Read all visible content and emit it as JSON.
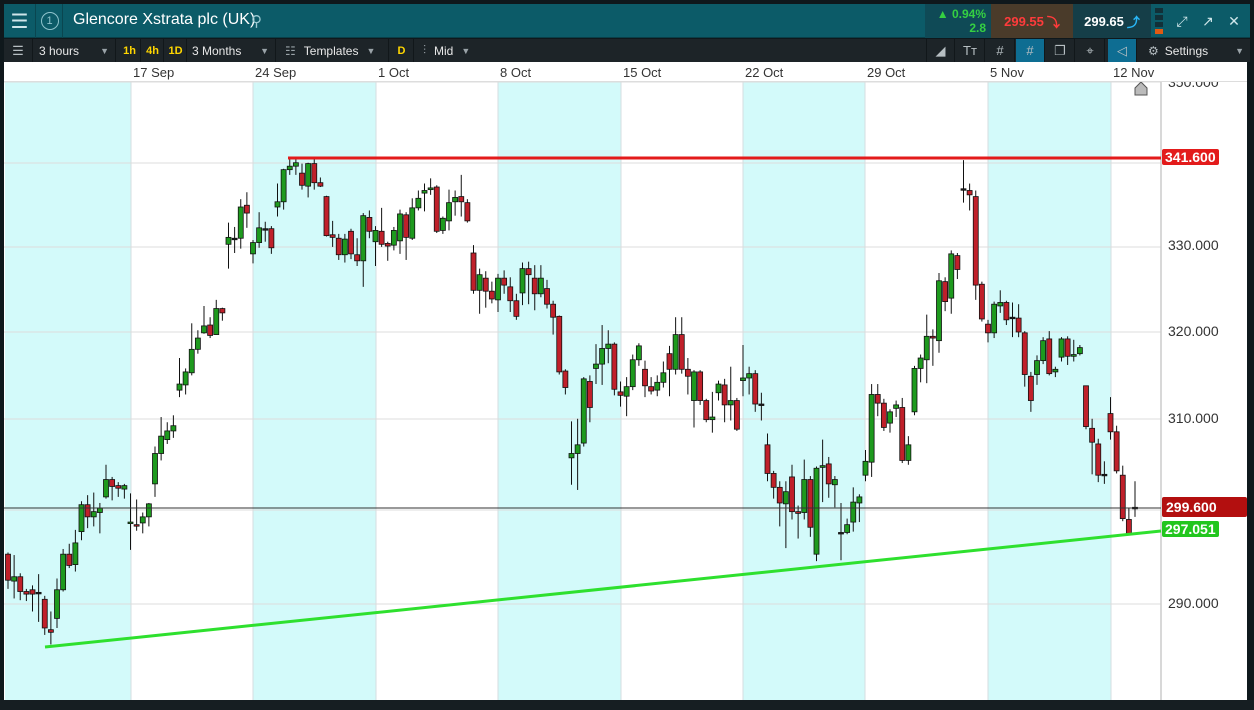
{
  "header": {
    "title": "Glencore Xstrata plc (UK)",
    "change_pct": "▲ 0.94%",
    "change_abs": "2.8",
    "sell_price": "299.55",
    "buy_price": "299.65",
    "watch_number": "1"
  },
  "toolbar": {
    "interval": "3 hours",
    "quick": [
      "1h",
      "4h",
      "1D"
    ],
    "range": "3 Months",
    "templates": "Templates",
    "d_label": "D",
    "price_type": "Mid",
    "settings": "Settings"
  },
  "colors": {
    "up": "#1e9a1e",
    "down": "#c0202a",
    "resistance": "#e31b1b",
    "support": "#2ee02e",
    "shade": "#d3fafa"
  },
  "chart_data": {
    "type": "candlestick",
    "interval": "3 hours",
    "x_ticks": [
      "17 Sep",
      "24 Sep",
      "1 Oct",
      "8 Oct",
      "15 Oct",
      "22 Oct",
      "29 Oct",
      "5 Nov",
      "12 Nov"
    ],
    "y_ticks": [
      "350.000",
      "330.000",
      "320.000",
      "310.000",
      "290.000"
    ],
    "ylim": [
      278.8,
      350
    ],
    "lines": {
      "resistance": "341.600",
      "last": "299.600",
      "support": "297.051"
    },
    "candles": [
      [
        295.6,
        295.8,
        291.6,
        292.6
      ],
      [
        292.5,
        295.5,
        290.5,
        293.0
      ],
      [
        293.0,
        293.4,
        290.3,
        291.3
      ],
      [
        291.3,
        291.6,
        290.2,
        291.0
      ],
      [
        291.5,
        292.0,
        289.0,
        291.0
      ],
      [
        291.2,
        293.3,
        287.8,
        291.2
      ],
      [
        290.4,
        290.8,
        286.3,
        287.1
      ],
      [
        286.9,
        289.0,
        285.2,
        286.6
      ],
      [
        288.2,
        292.8,
        287.1,
        291.5
      ],
      [
        291.5,
        296.2,
        291.3,
        295.6
      ],
      [
        295.6,
        296.8,
        294.0,
        294.3
      ],
      [
        294.4,
        298.4,
        293.6,
        296.9
      ],
      [
        298.2,
        301.7,
        297.2,
        301.3
      ],
      [
        301.3,
        302.4,
        298.6,
        299.9
      ],
      [
        299.9,
        302.7,
        298.8,
        300.5
      ],
      [
        300.4,
        301.5,
        298.0,
        300.9
      ],
      [
        302.2,
        305.9,
        302.0,
        304.2
      ],
      [
        304.2,
        304.5,
        301.8,
        303.4
      ],
      [
        303.5,
        303.9,
        302.2,
        303.2
      ],
      [
        303.1,
        303.7,
        302.0,
        303.5
      ],
      [
        299.2,
        302.6,
        296.1,
        299.3
      ],
      [
        299.0,
        301.9,
        298.3,
        298.9
      ],
      [
        299.2,
        300.4,
        298.0,
        299.9
      ],
      [
        299.9,
        301.5,
        298.8,
        301.4
      ],
      [
        303.7,
        308.0,
        302.2,
        307.2
      ],
      [
        307.2,
        311.4,
        306.4,
        309.2
      ],
      [
        308.8,
        310.8,
        308.3,
        309.8
      ],
      [
        309.8,
        311.6,
        309.0,
        310.4
      ],
      [
        314.5,
        318.2,
        313.7,
        315.2
      ],
      [
        315.1,
        317.0,
        314.0,
        316.6
      ],
      [
        316.5,
        322.2,
        316.2,
        319.2
      ],
      [
        319.2,
        321.4,
        318.7,
        320.5
      ],
      [
        321.1,
        324.2,
        321.0,
        321.9
      ],
      [
        322.0,
        322.9,
        320.5,
        320.8
      ],
      [
        320.9,
        324.9,
        320.9,
        323.9
      ],
      [
        323.9,
        324.0,
        322.5,
        323.4
      ],
      [
        331.3,
        333.8,
        328.5,
        332.1
      ],
      [
        332.0,
        333.3,
        330.3,
        332.0
      ],
      [
        332.0,
        336.5,
        330.8,
        335.6
      ],
      [
        335.8,
        337.3,
        333.2,
        334.9
      ],
      [
        330.2,
        331.8,
        329.1,
        331.5
      ],
      [
        331.5,
        335.0,
        330.9,
        333.2
      ],
      [
        333.1,
        333.9,
        331.6,
        333.1
      ],
      [
        333.1,
        333.4,
        330.2,
        330.9
      ],
      [
        335.6,
        338.3,
        334.5,
        336.2
      ],
      [
        336.2,
        340.0,
        335.3,
        339.9
      ],
      [
        339.9,
        341.2,
        339.3,
        340.3
      ],
      [
        340.3,
        341.3,
        339.3,
        340.7
      ],
      [
        339.5,
        340.6,
        337.6,
        338.1
      ],
      [
        338.0,
        340.7,
        336.7,
        340.6
      ],
      [
        340.6,
        341.3,
        337.6,
        338.4
      ],
      [
        338.4,
        339.0,
        337.9,
        338.0
      ],
      [
        336.8,
        336.9,
        332.2,
        332.3
      ],
      [
        332.4,
        334.0,
        331.0,
        332.1
      ],
      [
        332.0,
        332.5,
        329.5,
        330.1
      ],
      [
        330.1,
        332.5,
        329.2,
        331.9
      ],
      [
        332.8,
        333.1,
        329.6,
        330.2
      ],
      [
        330.1,
        332.0,
        328.8,
        329.4
      ],
      [
        329.4,
        334.9,
        326.4,
        334.6
      ],
      [
        334.4,
        335.2,
        332.0,
        332.8
      ],
      [
        331.6,
        333.4,
        328.8,
        332.9
      ],
      [
        332.8,
        335.5,
        331.0,
        331.3
      ],
      [
        331.4,
        331.6,
        329.4,
        331.1
      ],
      [
        331.2,
        333.3,
        330.6,
        332.9
      ],
      [
        331.7,
        335.3,
        330.2,
        334.8
      ],
      [
        334.7,
        335.0,
        329.5,
        332.1
      ],
      [
        332.0,
        336.6,
        331.8,
        335.5
      ],
      [
        335.5,
        337.5,
        335.2,
        336.6
      ],
      [
        337.2,
        338.3,
        335.1,
        337.5
      ],
      [
        337.6,
        338.9,
        337.0,
        337.8
      ],
      [
        337.9,
        338.1,
        332.6,
        332.8
      ],
      [
        332.9,
        334.5,
        332.5,
        334.3
      ],
      [
        334.0,
        337.6,
        332.9,
        336.1
      ],
      [
        336.2,
        337.5,
        334.6,
        336.7
      ],
      [
        336.8,
        339.3,
        334.5,
        336.2
      ],
      [
        336.1,
        336.5,
        333.8,
        334.0
      ],
      [
        330.3,
        331.2,
        325.6,
        326.0
      ],
      [
        326.0,
        328.5,
        323.3,
        327.8
      ],
      [
        327.4,
        328.2,
        324.0,
        325.9
      ],
      [
        325.9,
        327.0,
        324.5,
        325.0
      ],
      [
        324.9,
        327.9,
        323.5,
        327.4
      ],
      [
        327.4,
        328.3,
        325.6,
        326.6
      ],
      [
        326.4,
        327.5,
        323.5,
        324.8
      ],
      [
        324.8,
        325.6,
        322.6,
        323.0
      ],
      [
        325.7,
        329.2,
        324.3,
        328.5
      ],
      [
        328.5,
        329.3,
        324.4,
        327.8
      ],
      [
        327.4,
        328.9,
        323.7,
        325.6
      ],
      [
        325.6,
        328.9,
        325.2,
        327.4
      ],
      [
        326.2,
        327.2,
        323.9,
        324.4
      ],
      [
        324.4,
        324.8,
        320.9,
        322.9
      ],
      [
        323.0,
        323.1,
        316.3,
        316.6
      ],
      [
        316.7,
        316.9,
        314.0,
        314.8
      ],
      [
        306.7,
        310.9,
        303.6,
        307.2
      ],
      [
        307.2,
        311.2,
        303.0,
        308.2
      ],
      [
        308.4,
        316.0,
        308.0,
        315.8
      ],
      [
        315.5,
        316.2,
        310.8,
        312.5
      ],
      [
        317.0,
        319.8,
        315.2,
        317.5
      ],
      [
        317.5,
        322.0,
        315.1,
        319.3
      ],
      [
        319.3,
        321.4,
        317.6,
        319.8
      ],
      [
        319.8,
        320.0,
        313.9,
        314.6
      ],
      [
        314.3,
        315.5,
        312.6,
        313.9
      ],
      [
        313.8,
        316.0,
        311.5,
        314.9
      ],
      [
        314.9,
        318.6,
        314.5,
        318.0
      ],
      [
        318.0,
        319.9,
        317.3,
        319.6
      ],
      [
        316.9,
        317.9,
        313.7,
        315.0
      ],
      [
        314.9,
        316.0,
        314.0,
        314.4
      ],
      [
        314.5,
        316.2,
        313.8,
        315.4
      ],
      [
        315.4,
        317.8,
        314.8,
        316.5
      ],
      [
        318.7,
        319.6,
        313.8,
        316.9
      ],
      [
        316.9,
        322.9,
        316.3,
        320.9
      ],
      [
        320.9,
        322.9,
        316.4,
        316.9
      ],
      [
        316.9,
        318.2,
        314.0,
        316.1
      ],
      [
        313.3,
        316.8,
        310.2,
        316.6
      ],
      [
        316.6,
        316.8,
        312.8,
        313.3
      ],
      [
        313.3,
        313.5,
        310.8,
        311.1
      ],
      [
        311.1,
        314.3,
        309.6,
        311.4
      ],
      [
        314.2,
        315.6,
        313.3,
        315.2
      ],
      [
        315.1,
        315.8,
        310.8,
        312.8
      ],
      [
        312.8,
        317.2,
        311.0,
        313.3
      ],
      [
        313.3,
        313.6,
        309.8,
        310.0
      ],
      [
        315.6,
        319.7,
        313.8,
        315.9
      ],
      [
        315.9,
        317.2,
        314.0,
        316.4
      ],
      [
        316.4,
        316.8,
        312.0,
        312.9
      ],
      [
        312.9,
        314.2,
        311.0,
        312.9
      ],
      [
        308.2,
        309.5,
        304.0,
        304.9
      ],
      [
        304.9,
        305.2,
        302.0,
        303.3
      ],
      [
        303.3,
        304.0,
        298.8,
        301.5
      ],
      [
        301.4,
        304.0,
        296.3,
        302.8
      ],
      [
        304.5,
        305.9,
        299.6,
        300.5
      ],
      [
        300.5,
        301.2,
        297.4,
        300.3
      ],
      [
        300.4,
        306.5,
        299.6,
        304.2
      ],
      [
        304.2,
        304.6,
        297.6,
        298.7
      ],
      [
        295.6,
        305.7,
        294.8,
        305.5
      ],
      [
        305.6,
        308.8,
        301.6,
        305.8
      ],
      [
        306.0,
        306.8,
        302.1,
        303.7
      ],
      [
        303.6,
        304.6,
        301.0,
        304.2
      ],
      [
        298.1,
        301.5,
        294.9,
        298.1
      ],
      [
        298.1,
        299.7,
        297.9,
        299.0
      ],
      [
        299.3,
        303.3,
        298.2,
        301.6
      ],
      [
        301.5,
        302.5,
        299.3,
        302.2
      ],
      [
        304.7,
        307.6,
        304.0,
        306.3
      ],
      [
        306.2,
        315.2,
        304.5,
        314.0
      ],
      [
        314.0,
        315.2,
        311.5,
        313.0
      ],
      [
        313.0,
        313.5,
        309.8,
        310.2
      ],
      [
        310.7,
        312.3,
        309.6,
        312.0
      ],
      [
        312.4,
        313.3,
        311.4,
        312.8
      ],
      [
        312.5,
        313.6,
        306.1,
        306.4
      ],
      [
        306.4,
        309.2,
        305.9,
        308.2
      ],
      [
        312.0,
        317.3,
        311.6,
        317.0
      ],
      [
        317.0,
        318.6,
        315.4,
        318.2
      ],
      [
        318.0,
        323.2,
        315.3,
        320.7
      ],
      [
        320.7,
        321.5,
        317.3,
        320.5
      ],
      [
        320.2,
        328.0,
        318.8,
        327.1
      ],
      [
        327.0,
        327.5,
        323.6,
        324.7
      ],
      [
        325.1,
        330.6,
        323.3,
        330.2
      ],
      [
        330.0,
        330.3,
        327.3,
        328.4
      ],
      [
        337.7,
        341.0,
        336.1,
        337.7
      ],
      [
        337.5,
        338.3,
        335.2,
        337.0
      ],
      [
        336.8,
        337.5,
        324.9,
        326.6
      ],
      [
        326.7,
        327.0,
        322.4,
        322.7
      ],
      [
        322.1,
        322.6,
        320.0,
        321.1
      ],
      [
        321.1,
        324.7,
        320.5,
        324.4
      ],
      [
        324.2,
        326.0,
        323.4,
        324.6
      ],
      [
        324.6,
        324.8,
        322.0,
        322.6
      ],
      [
        322.9,
        324.6,
        320.6,
        322.9
      ],
      [
        322.8,
        324.4,
        320.6,
        321.2
      ],
      [
        321.1,
        321.3,
        314.9,
        316.3
      ],
      [
        316.1,
        316.6,
        312.0,
        313.3
      ],
      [
        316.3,
        318.5,
        315.1,
        317.9
      ],
      [
        317.9,
        320.6,
        317.5,
        320.2
      ],
      [
        320.4,
        321.3,
        316.2,
        316.4
      ],
      [
        316.6,
        317.2,
        316.0,
        316.9
      ],
      [
        318.3,
        320.6,
        317.8,
        320.4
      ],
      [
        320.4,
        320.7,
        317.4,
        318.4
      ],
      [
        318.4,
        320.3,
        317.8,
        318.6
      ],
      [
        318.7,
        319.7,
        318.5,
        319.4
      ],
      [
        315.0,
        315.0,
        310.0,
        310.3
      ],
      [
        310.1,
        311.2,
        304.8,
        308.5
      ],
      [
        308.3,
        308.9,
        303.9,
        304.7
      ],
      [
        304.8,
        306.3,
        303.7,
        304.8
      ],
      [
        311.8,
        313.7,
        308.8,
        309.7
      ],
      [
        309.7,
        310.4,
        304.9,
        305.2
      ],
      [
        304.7,
        305.8,
        299.4,
        299.7
      ],
      [
        299.6,
        300.9,
        297.9,
        298.0
      ],
      [
        301.0,
        304.0,
        299.9,
        301.0
      ]
    ]
  }
}
